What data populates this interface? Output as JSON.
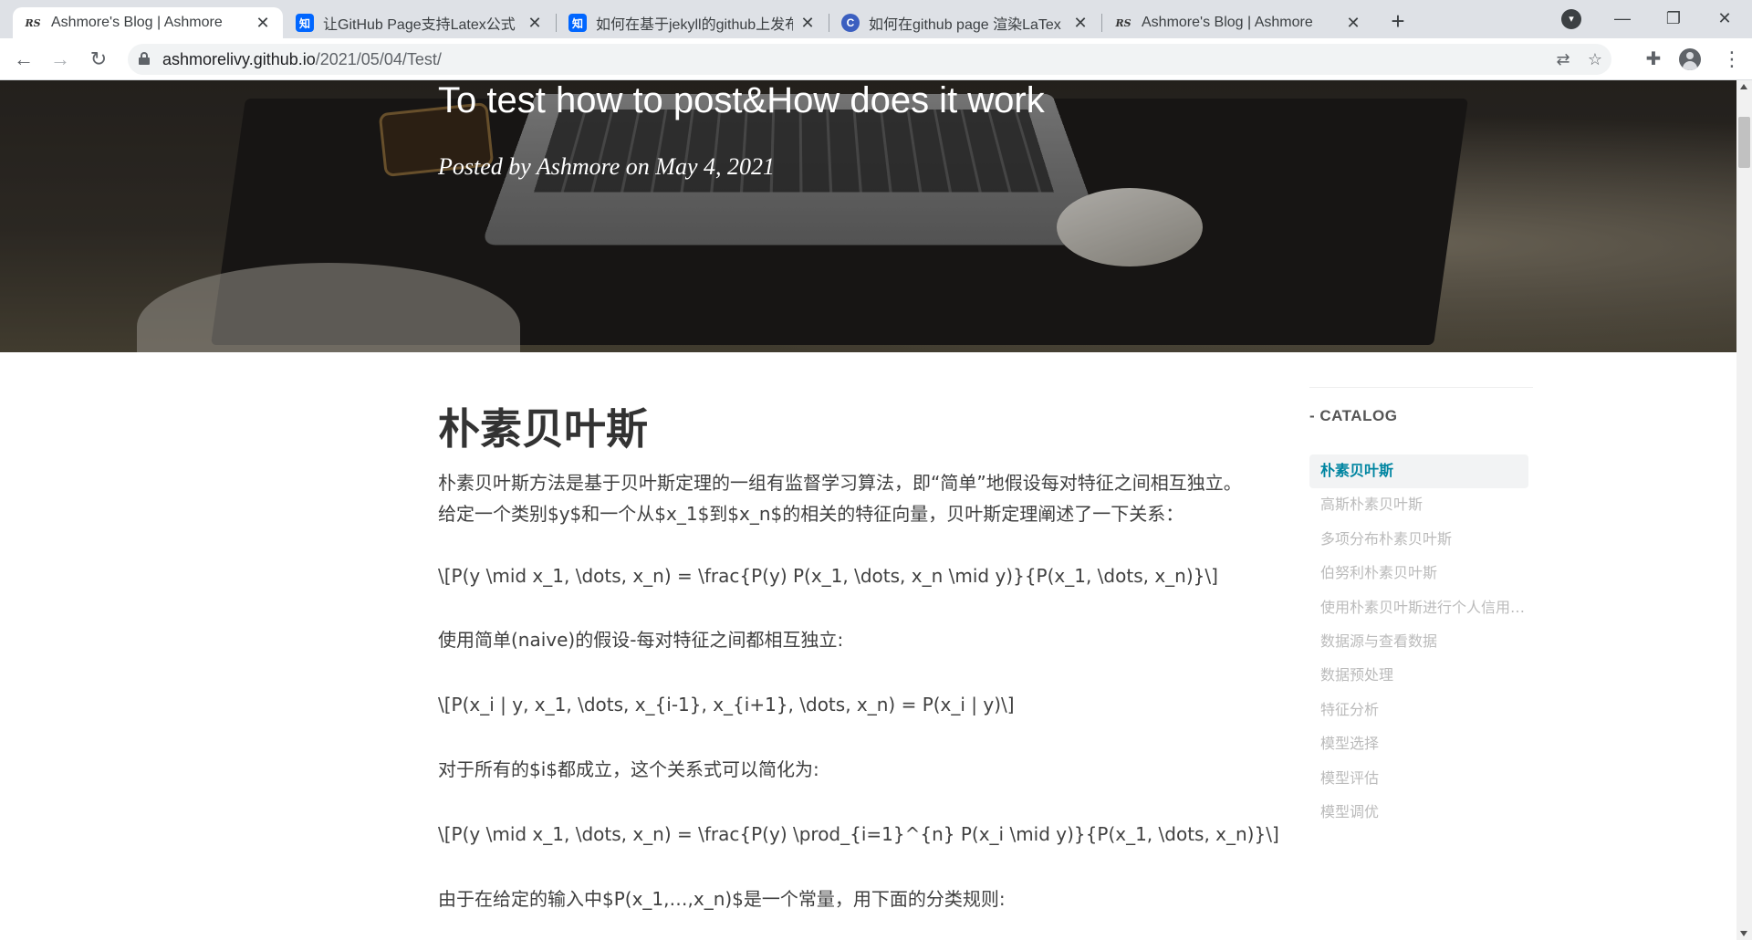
{
  "browser": {
    "tabs": [
      {
        "title": "Ashmore's Blog | Ashmore",
        "favicon": "rs-logo-icon",
        "active": true
      },
      {
        "title": "让GitHub Page支持Latex公式 -",
        "favicon": "zhihu-icon",
        "active": false
      },
      {
        "title": "如何在基于jekyll的github上发布",
        "favicon": "zhihu-icon",
        "active": false
      },
      {
        "title": "如何在github page 渲染LaTex",
        "favicon": "blue-circle-icon",
        "active": false
      },
      {
        "title": "Ashmore's Blog | Ashmore",
        "favicon": "rs-logo-icon",
        "active": false
      }
    ],
    "favicon_labels": {
      "rs": "RS",
      "zhihu": "知",
      "circle": "C"
    },
    "address": {
      "host": "ashmorelivy.github.io",
      "path": "/2021/05/04/Test/"
    }
  },
  "hero": {
    "title": "To test how to post&How does it work",
    "meta": "Posted by Ashmore on May 4, 2021"
  },
  "article": {
    "heading": "朴素贝叶斯",
    "paragraphs": [
      "朴素贝叶斯方法是基于贝叶斯定理的一组有监督学习算法，即“简单”地假设每对特征之间相互独立。",
      "给定一个类别$y$和一个从$x_1$到$x_n$的相关的特征向量，贝叶斯定理阐述了一下关系：",
      "\\[P(y \\mid x_1, \\dots, x_n) = \\frac{P(y) P(x_1, \\dots, x_n \\mid y)}{P(x_1, \\dots, x_n)}\\]",
      "使用简单(naive)的假设-每对特征之间都相互独立:",
      "\\[P(x_i | y, x_1, \\dots, x_{i-1}, x_{i+1}, \\dots, x_n) = P(x_i | y)\\]",
      "对于所有的$i$都成立，这个关系式可以简化为:",
      "\\[P(y \\mid x_1, \\dots, x_n) = \\frac{P(y) \\prod_{i=1}^{n} P(x_i \\mid y)}{P(x_1, \\dots, x_n)}\\]",
      "由于在给定的输入中$P(x_1,…,x_n)$是一个常量，用下面的分类规则:"
    ]
  },
  "catalog": {
    "title": "CATALOG",
    "items": [
      "朴素贝叶斯",
      "高斯朴素贝叶斯",
      "多项分布朴素贝叶斯",
      "伯努利朴素贝叶斯",
      "使用朴素贝叶斯进行个人信用风险评估",
      "数据源与查看数据",
      "数据预处理",
      "特征分析",
      "模型选择",
      "模型评估",
      "模型调优"
    ],
    "active_index": 0,
    "accent_color": "#0085a1"
  }
}
